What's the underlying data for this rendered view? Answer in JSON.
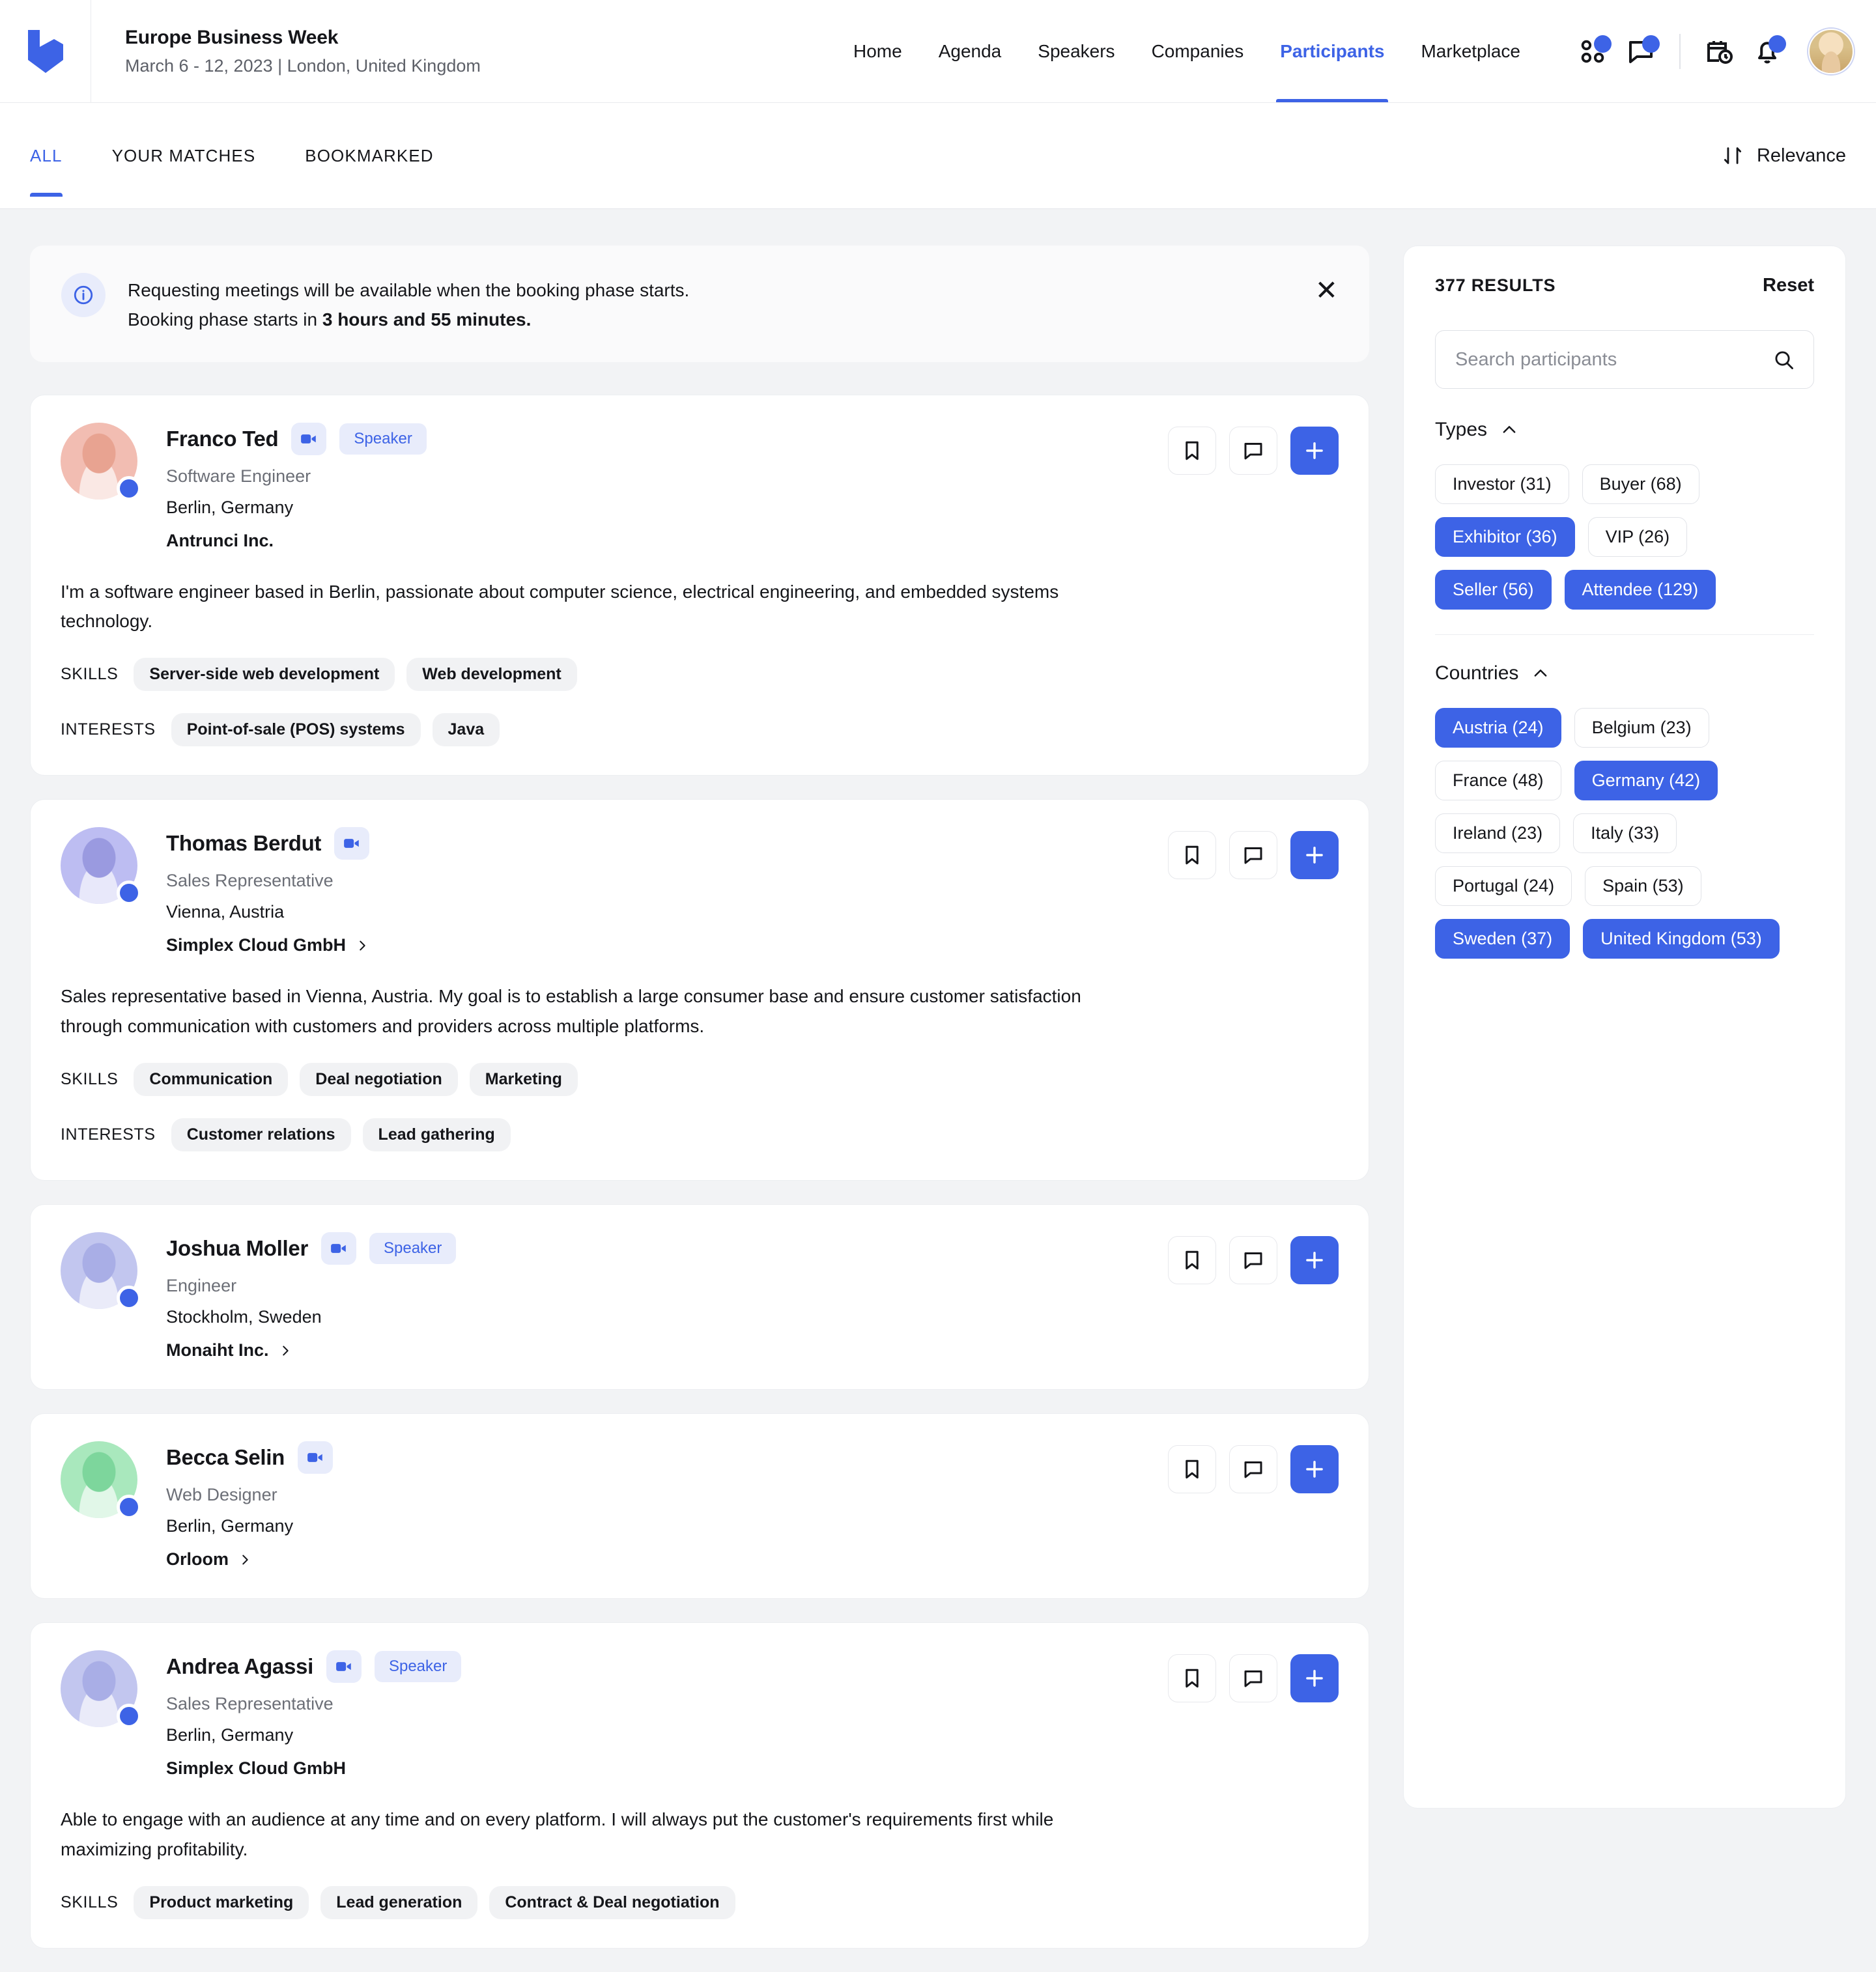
{
  "header": {
    "logo_icon": "brand-logo-icon",
    "event_title": "Europe Business Week",
    "event_subtitle": "March 6 - 12, 2023 | London, United Kingdom",
    "nav": [
      {
        "label": "Home",
        "active": false
      },
      {
        "label": "Agenda",
        "active": false
      },
      {
        "label": "Speakers",
        "active": false
      },
      {
        "label": "Companies",
        "active": false
      },
      {
        "label": "Participants",
        "active": true
      },
      {
        "label": "Marketplace",
        "active": false
      }
    ],
    "icons": [
      {
        "name": "matches-icon",
        "badge": true
      },
      {
        "name": "messages-icon",
        "badge": true
      },
      {
        "name": "schedule-calendar-icon",
        "badge": false
      },
      {
        "name": "notifications-bell-icon",
        "badge": true
      }
    ],
    "avatar": "user-avatar"
  },
  "tabbar": {
    "tabs": [
      {
        "label": "ALL",
        "active": true
      },
      {
        "label": "YOUR MATCHES",
        "active": false
      },
      {
        "label": "BOOKMARKED",
        "active": false
      }
    ],
    "sort_label": "Relevance",
    "sort_icon": "sort-arrows-icon"
  },
  "banner": {
    "icon": "info-icon",
    "line1": "Requesting meetings will be available when the booking phase starts.",
    "line2_prefix": "Booking phase starts in ",
    "line2_strong": "3 hours and 55 minutes.",
    "close_icon": "close-icon"
  },
  "actions": {
    "bookmark_icon": "bookmark-icon",
    "message_icon": "message-icon",
    "add_icon": "plus-icon"
  },
  "labels": {
    "skills": "SKILLS",
    "interests": "INTERESTS",
    "speaker_badge": "Speaker",
    "video_icon": "video-camera-icon",
    "chevron_icon": "chevron-right-icon"
  },
  "participants": [
    {
      "name": "Franco Ted",
      "video": true,
      "speaker": true,
      "role": "Software Engineer",
      "location": "Berlin, Germany",
      "company": "Antrunci Inc.",
      "company_link": false,
      "bio": "I'm a software engineer based in Berlin, passionate about computer science, electrical engineering, and embedded systems technology.",
      "skills": [
        "Server-side web development",
        "Web development"
      ],
      "interests": [
        "Point-of-sale (POS) systems",
        "Java"
      ],
      "avatar_bg": "#f2bdb2",
      "avatar_tone": "#e8a391"
    },
    {
      "name": "Thomas Berdut",
      "video": true,
      "speaker": false,
      "role": "Sales Representative",
      "location": "Vienna, Austria",
      "company": "Simplex Cloud GmbH",
      "company_link": true,
      "bio": "Sales representative based in Vienna, Austria. My goal is to establish a large consumer base and ensure customer satisfaction through communication with customers and providers across multiple platforms.",
      "skills": [
        "Communication",
        "Deal negotiation",
        "Marketing"
      ],
      "interests": [
        "Customer relations",
        "Lead gathering"
      ],
      "avatar_bg": "#bdbdf2",
      "avatar_tone": "#9a9ae0"
    },
    {
      "name": "Joshua Moller",
      "video": true,
      "speaker": true,
      "role": "Engineer",
      "location": "Stockholm, Sweden",
      "company": "Monaiht Inc.",
      "company_link": true,
      "bio": "",
      "skills": [],
      "interests": [],
      "avatar_bg": "#c2c6ef",
      "avatar_tone": "#a9aee6"
    },
    {
      "name": "Becca Selin",
      "video": true,
      "speaker": false,
      "role": "Web Designer",
      "location": "Berlin, Germany",
      "company": "Orloom",
      "company_link": true,
      "bio": "",
      "skills": [],
      "interests": [],
      "avatar_bg": "#a9e8bd",
      "avatar_tone": "#7dd69c"
    },
    {
      "name": "Andrea Agassi",
      "video": true,
      "speaker": true,
      "role": "Sales Representative",
      "location": "Berlin, Germany",
      "company": "Simplex Cloud GmbH",
      "company_link": false,
      "bio": "Able to engage with an audience at any time and on every platform. I will always put the customer's requirements first while maximizing profitability.",
      "skills": [
        "Product marketing",
        "Lead generation",
        "Contract & Deal negotiation"
      ],
      "interests": [],
      "avatar_bg": "#c2c6ef",
      "avatar_tone": "#a9aee6"
    }
  ],
  "filters": {
    "results": "377 RESULTS",
    "reset": "Reset",
    "search_placeholder": "Search participants",
    "search_value": "",
    "search_icon": "search-icon",
    "sections": [
      {
        "title": "Types",
        "collapse_icon": "chevron-up-icon",
        "chips": [
          {
            "label": "Investor (31)",
            "selected": false
          },
          {
            "label": "Buyer (68)",
            "selected": false
          },
          {
            "label": "Exhibitor (36)",
            "selected": true
          },
          {
            "label": "VIP (26)",
            "selected": false
          },
          {
            "label": "Seller (56)",
            "selected": true
          },
          {
            "label": "Attendee (129)",
            "selected": true
          }
        ]
      },
      {
        "title": "Countries",
        "collapse_icon": "chevron-up-icon",
        "chips": [
          {
            "label": "Austria (24)",
            "selected": true
          },
          {
            "label": "Belgium (23)",
            "selected": false
          },
          {
            "label": "France (48)",
            "selected": false
          },
          {
            "label": "Germany (42)",
            "selected": true
          },
          {
            "label": "Ireland (23)",
            "selected": false
          },
          {
            "label": "Italy (33)",
            "selected": false
          },
          {
            "label": "Portugal (24)",
            "selected": false
          },
          {
            "label": "Spain (53)",
            "selected": false
          },
          {
            "label": "Sweden (37)",
            "selected": true
          },
          {
            "label": "United Kingdom (53)",
            "selected": true
          }
        ]
      }
    ]
  },
  "colors": {
    "accent": "#3d63e6",
    "accent_soft": "#e8ecfb",
    "page_bg": "#f2f3f5",
    "text": "#15161a",
    "muted": "#6c6f77"
  }
}
